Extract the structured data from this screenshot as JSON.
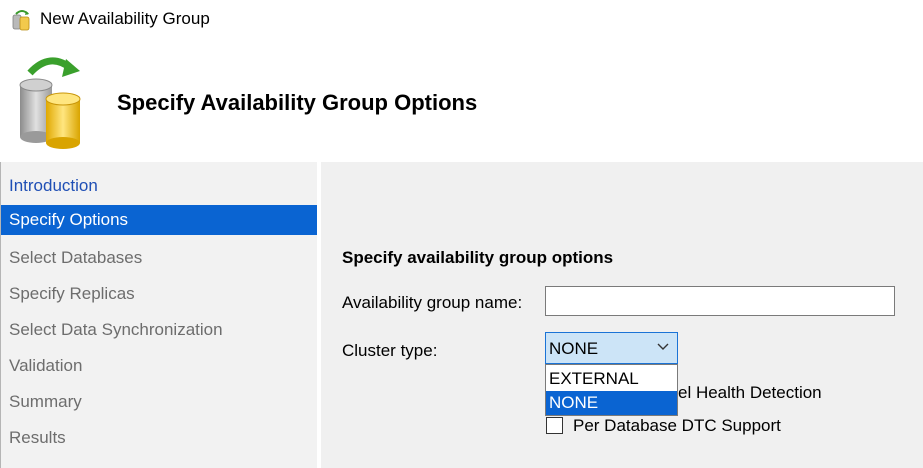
{
  "window": {
    "title": "New Availability Group",
    "icon": "availability-group-icon"
  },
  "header": {
    "title": "Specify Availability Group Options",
    "icon": "database-sync-icon"
  },
  "sidebar": {
    "items": [
      {
        "label": "Introduction",
        "state": "link"
      },
      {
        "label": "Specify Options",
        "state": "selected"
      },
      {
        "label": "Select Databases",
        "state": "disabled"
      },
      {
        "label": "Specify Replicas",
        "state": "disabled"
      },
      {
        "label": "Select Data Synchronization",
        "state": "disabled"
      },
      {
        "label": "Validation",
        "state": "disabled"
      },
      {
        "label": "Summary",
        "state": "disabled"
      },
      {
        "label": "Results",
        "state": "disabled"
      }
    ]
  },
  "main": {
    "section_title": "Specify availability group options",
    "name_label": "Availability group name:",
    "name_value": "",
    "cluster_label": "Cluster type:",
    "cluster_value": "NONE",
    "cluster_options": [
      {
        "label": "EXTERNAL",
        "selected": false
      },
      {
        "label": "NONE",
        "selected": true
      }
    ],
    "health_checkbox_label": "Database Level Health Detection",
    "health_checkbox_visible": "el Health Detection",
    "dtc_checkbox_label": "Per Database DTC Support",
    "health_checked": false,
    "dtc_checked": false
  },
  "colors": {
    "accent": "#0a64d2",
    "link": "#1f4fb5",
    "panel": "#f2f2f2"
  }
}
